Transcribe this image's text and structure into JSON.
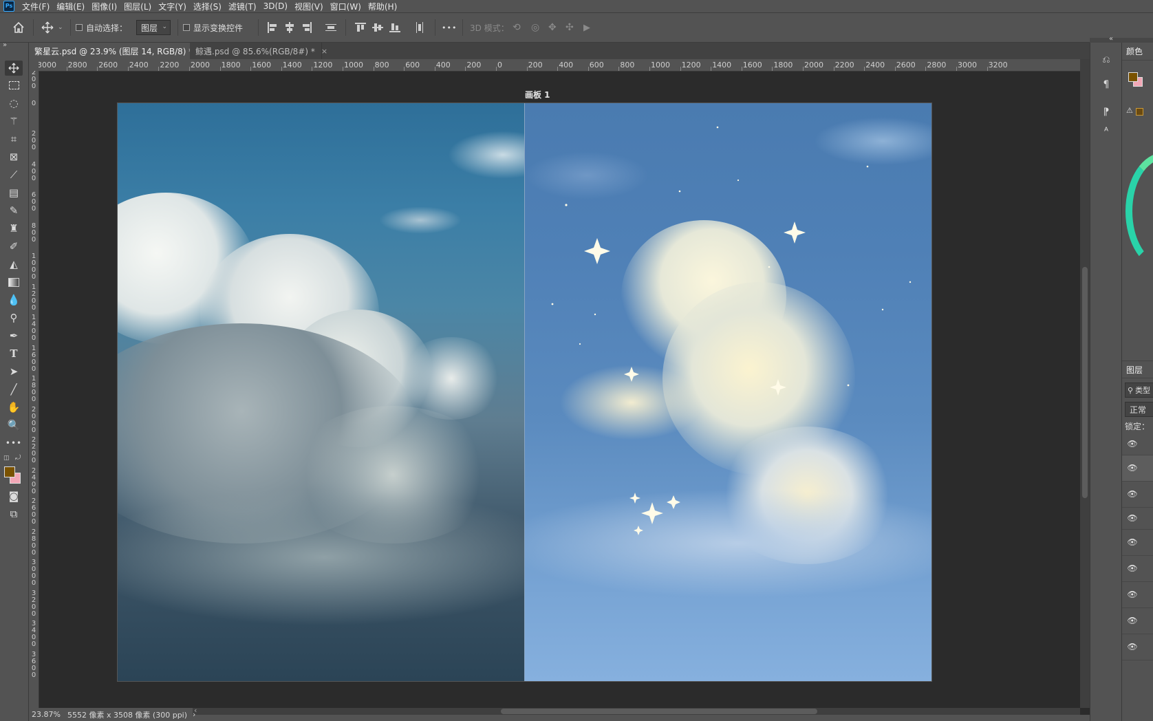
{
  "menubar": {
    "logo": "Ps",
    "items": [
      "文件(F)",
      "编辑(E)",
      "图像(I)",
      "图层(L)",
      "文字(Y)",
      "选择(S)",
      "滤镜(T)",
      "3D(D)",
      "视图(V)",
      "窗口(W)",
      "帮助(H)"
    ]
  },
  "options": {
    "auto_select_label": "自动选择：",
    "layer_select_value": "图层",
    "show_transform_label": "显示变换控件",
    "more_label": "•••",
    "mode_3d_label": "3D 模式："
  },
  "tabs": [
    {
      "label": "繁星云.psd @ 23.9% (图层 14, RGB/8) *",
      "close": "×"
    },
    {
      "label": "鲸遇.psd @ 85.6%(RGB/8#) *",
      "close": "×"
    }
  ],
  "ruler_h": [
    "3000",
    "2800",
    "2600",
    "2400",
    "2200",
    "2000",
    "1800",
    "1600",
    "1400",
    "1200",
    "1000",
    "800",
    "600",
    "400",
    "200",
    "0",
    "200",
    "400",
    "600",
    "800",
    "1000",
    "1200",
    "1400",
    "1600",
    "1800",
    "2000",
    "2200",
    "2400",
    "2600",
    "2800",
    "3000",
    "3200"
  ],
  "ruler_v": [
    "200",
    "0",
    "200",
    "400",
    "600",
    "800",
    "1000",
    "1200",
    "1400",
    "1600",
    "1800",
    "2000",
    "2200",
    "2400",
    "2600",
    "2800",
    "3000",
    "3200",
    "3400",
    "3600"
  ],
  "canvas": {
    "artboard_label": "画板 1"
  },
  "statusbar": {
    "zoom": "23.87%",
    "doc_info": "5552 像素 x 3508 像素 (300 ppi)",
    "arrow": "›",
    "scroll_left": "‹"
  },
  "panels": {
    "color_title": "颜色",
    "layers_title": "图层",
    "layers_search_placeholder": "类型",
    "blend_mode": "正常",
    "lock_label": "锁定：",
    "colors": {
      "foreground": "#7a5200",
      "background": "#f2a7b6"
    }
  }
}
